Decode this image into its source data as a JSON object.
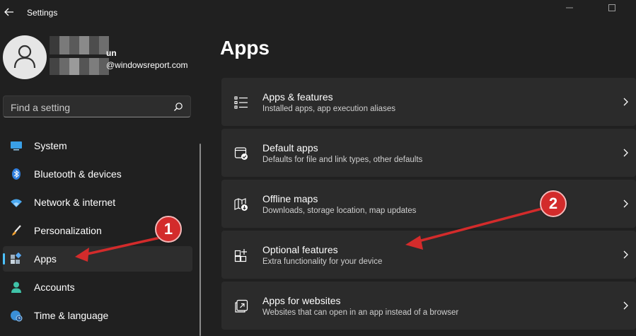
{
  "window": {
    "title": "Settings"
  },
  "profile": {
    "name_suffix": "un",
    "email": "@windowsreport.com"
  },
  "search": {
    "placeholder": "Find a setting"
  },
  "nav": {
    "items": [
      {
        "label": "System",
        "icon": "monitor-icon"
      },
      {
        "label": "Bluetooth & devices",
        "icon": "bluetooth-icon"
      },
      {
        "label": "Network & internet",
        "icon": "wifi-icon"
      },
      {
        "label": "Personalization",
        "icon": "paintbrush-icon"
      },
      {
        "label": "Apps",
        "icon": "apps-icon",
        "selected": true
      },
      {
        "label": "Accounts",
        "icon": "person-icon"
      },
      {
        "label": "Time & language",
        "icon": "globe-clock-icon"
      }
    ]
  },
  "main": {
    "title": "Apps",
    "cards": [
      {
        "title": "Apps & features",
        "description": "Installed apps, app execution aliases",
        "icon": "list-icon"
      },
      {
        "title": "Default apps",
        "description": "Defaults for file and link types, other defaults",
        "icon": "default-apps-icon"
      },
      {
        "title": "Offline maps",
        "description": "Downloads, storage location, map updates",
        "icon": "map-download-icon"
      },
      {
        "title": "Optional features",
        "description": "Extra functionality for your device",
        "icon": "grid-add-icon"
      },
      {
        "title": "Apps for websites",
        "description": "Websites that can open in an app instead of a browser",
        "icon": "open-link-icon"
      }
    ]
  },
  "annotations": {
    "step1": "1",
    "step2": "2",
    "color": "#d32b2b"
  },
  "colors": {
    "accent": "#4cc2ff",
    "background": "#202020",
    "card": "#2b2b2b"
  }
}
